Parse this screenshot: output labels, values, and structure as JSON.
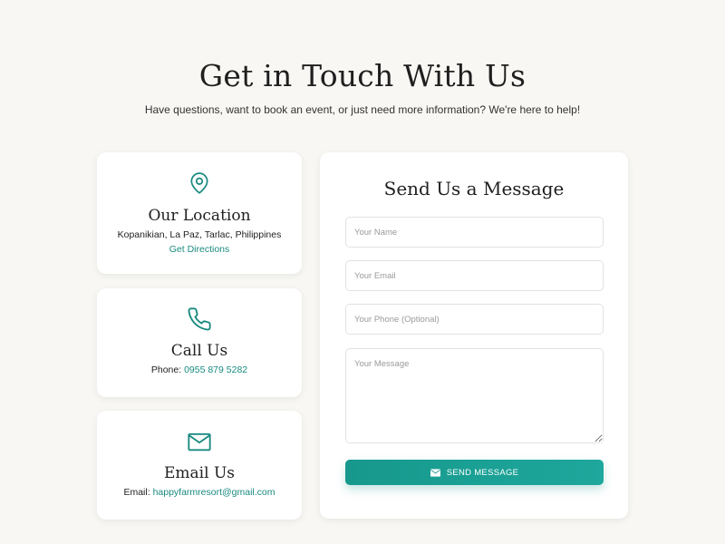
{
  "header": {
    "title": "Get in Touch With Us",
    "subtitle": "Have questions, want to book an event, or just need more information? We're here to help!"
  },
  "accent_color": "#1a8a80",
  "location": {
    "icon": "map-pin-icon",
    "title": "Our Location",
    "address": "Kopanikian, La Paz, Tarlac, Philippines",
    "link_label": "Get Directions"
  },
  "phone": {
    "icon": "phone-icon",
    "title": "Call Us",
    "label": "Phone: ",
    "number": "0955 879 5282"
  },
  "email": {
    "icon": "envelope-icon",
    "title": "Email Us",
    "label": "Email: ",
    "address": "happyfarmresort@gmail.com"
  },
  "form": {
    "title": "Send Us a Message",
    "name_placeholder": "Your Name",
    "email_placeholder": "Your Email",
    "phone_placeholder": "Your Phone (Optional)",
    "message_placeholder": "Your Message",
    "submit_label": "SEND MESSAGE",
    "submit_icon": "envelope-icon"
  }
}
